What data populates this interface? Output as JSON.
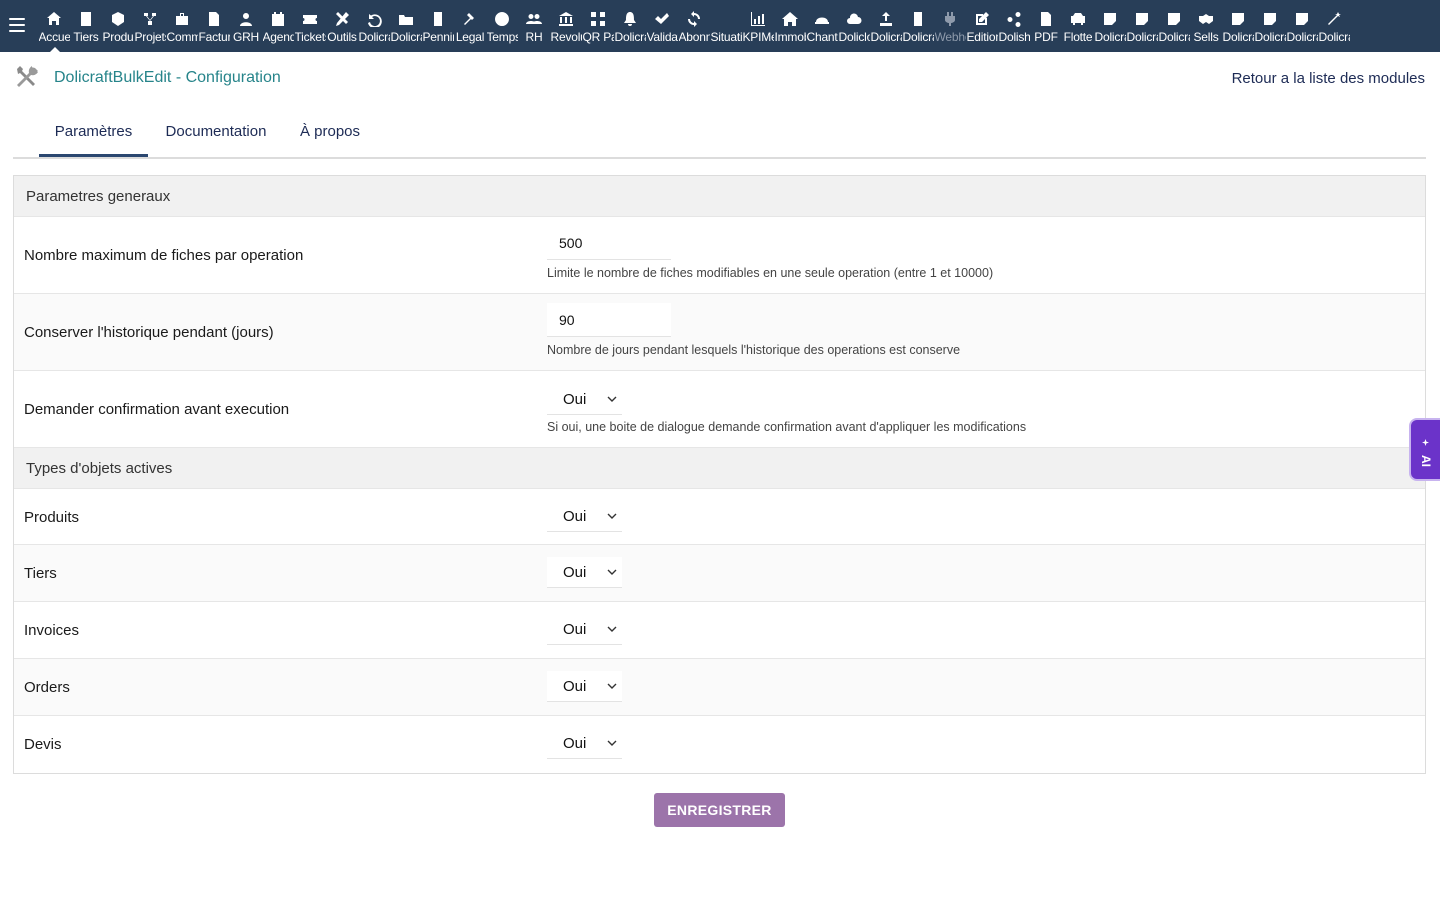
{
  "topbar": {
    "menu": [
      {
        "label": "Accueil",
        "icon": "home-icon",
        "active": true
      },
      {
        "label": "Tiers",
        "icon": "building-icon"
      },
      {
        "label": "Produits",
        "icon": "cube-icon"
      },
      {
        "label": "Projets",
        "icon": "project-icon"
      },
      {
        "label": "Commercial",
        "icon": "briefcase-icon"
      },
      {
        "label": "Facturation",
        "icon": "invoice-icon"
      },
      {
        "label": "GRH",
        "icon": "user-icon"
      },
      {
        "label": "Agenda",
        "icon": "calendar-icon"
      },
      {
        "label": "Tickets",
        "icon": "ticket-icon"
      },
      {
        "label": "Outils",
        "icon": "tools-icon"
      },
      {
        "label": "Dolicraft",
        "icon": "undo-icon"
      },
      {
        "label": "Dolicraft",
        "icon": "folder-icon"
      },
      {
        "label": "Penningaard",
        "icon": "doc-icon"
      },
      {
        "label": "Legal",
        "icon": "gavel-icon"
      },
      {
        "label": "Temps",
        "icon": "clock-icon"
      },
      {
        "label": "RH",
        "icon": "users-icon"
      },
      {
        "label": "Revolut",
        "icon": "bank-icon"
      },
      {
        "label": "QR Pay",
        "icon": "qrcode-icon"
      },
      {
        "label": "Dolicraft",
        "icon": "bell-icon"
      },
      {
        "label": "Validation",
        "icon": "check-icon"
      },
      {
        "label": "Abonnements",
        "icon": "refresh-icon"
      },
      {
        "label": "Situations",
        "icon": "blank-icon"
      },
      {
        "label": "KPIMetrics",
        "icon": "chart-icon"
      },
      {
        "label": "Immobilier",
        "icon": "house-icon"
      },
      {
        "label": "Chantier",
        "icon": "helmet-icon"
      },
      {
        "label": "Dolicloud",
        "icon": "cloud-icon"
      },
      {
        "label": "Dolicraft",
        "icon": "upload-icon"
      },
      {
        "label": "Dolicraft",
        "icon": "office-icon"
      },
      {
        "label": "Webhooks",
        "icon": "plug-icon",
        "dim": true
      },
      {
        "label": "Edition",
        "icon": "edit-icon"
      },
      {
        "label": "Dolishare",
        "icon": "share-icon"
      },
      {
        "label": "PDF",
        "icon": "pdf-icon"
      },
      {
        "label": "Flotte",
        "icon": "car-icon"
      },
      {
        "label": "Dolicraft",
        "icon": "note-icon"
      },
      {
        "label": "Dolicraft",
        "icon": "note-icon"
      },
      {
        "label": "Dolicraft",
        "icon": "note-icon"
      },
      {
        "label": "Sells",
        "icon": "handshake-icon"
      },
      {
        "label": "Dolicraft",
        "icon": "note-icon"
      },
      {
        "label": "Dolicraft",
        "icon": "note-icon"
      },
      {
        "label": "Dolicraft",
        "icon": "note-icon"
      },
      {
        "label": "Dolicraft",
        "icon": "wand-icon"
      }
    ]
  },
  "header": {
    "title": "DolicraftBulkEdit - Configuration",
    "back_link": "Retour a la liste des modules"
  },
  "tabs": [
    {
      "label": "Paramètres",
      "active": true
    },
    {
      "label": "Documentation"
    },
    {
      "label": "À propos"
    }
  ],
  "sections": {
    "general": {
      "title": "Parametres generaux",
      "max_records": {
        "label": "Nombre maximum de fiches par operation",
        "value": "500",
        "hint": "Limite le nombre de fiches modifiables en une seule operation (entre 1 et 10000)"
      },
      "history_days": {
        "label": "Conserver l'historique pendant (jours)",
        "value": "90",
        "hint": "Nombre de jours pendant lesquels l'historique des operations est conserve"
      },
      "confirm": {
        "label": "Demander confirmation avant execution",
        "value": "Oui",
        "hint": "Si oui, une boite de dialogue demande confirmation avant d'appliquer les modifications"
      }
    },
    "objects": {
      "title": "Types d'objets actives",
      "rows": [
        {
          "label": "Produits",
          "value": "Oui"
        },
        {
          "label": "Tiers",
          "value": "Oui"
        },
        {
          "label": "Invoices",
          "value": "Oui"
        },
        {
          "label": "Orders",
          "value": "Oui"
        },
        {
          "label": "Devis",
          "value": "Oui"
        }
      ]
    }
  },
  "submit_label": "ENREGISTRER",
  "ai_tab_label": "AI",
  "colors": {
    "topbar_bg": "#283e58",
    "title_teal": "#26848a",
    "link_navy": "#1d2b55",
    "submit_purple": "#9c74aa",
    "ai_purple": "#6b33c9"
  }
}
